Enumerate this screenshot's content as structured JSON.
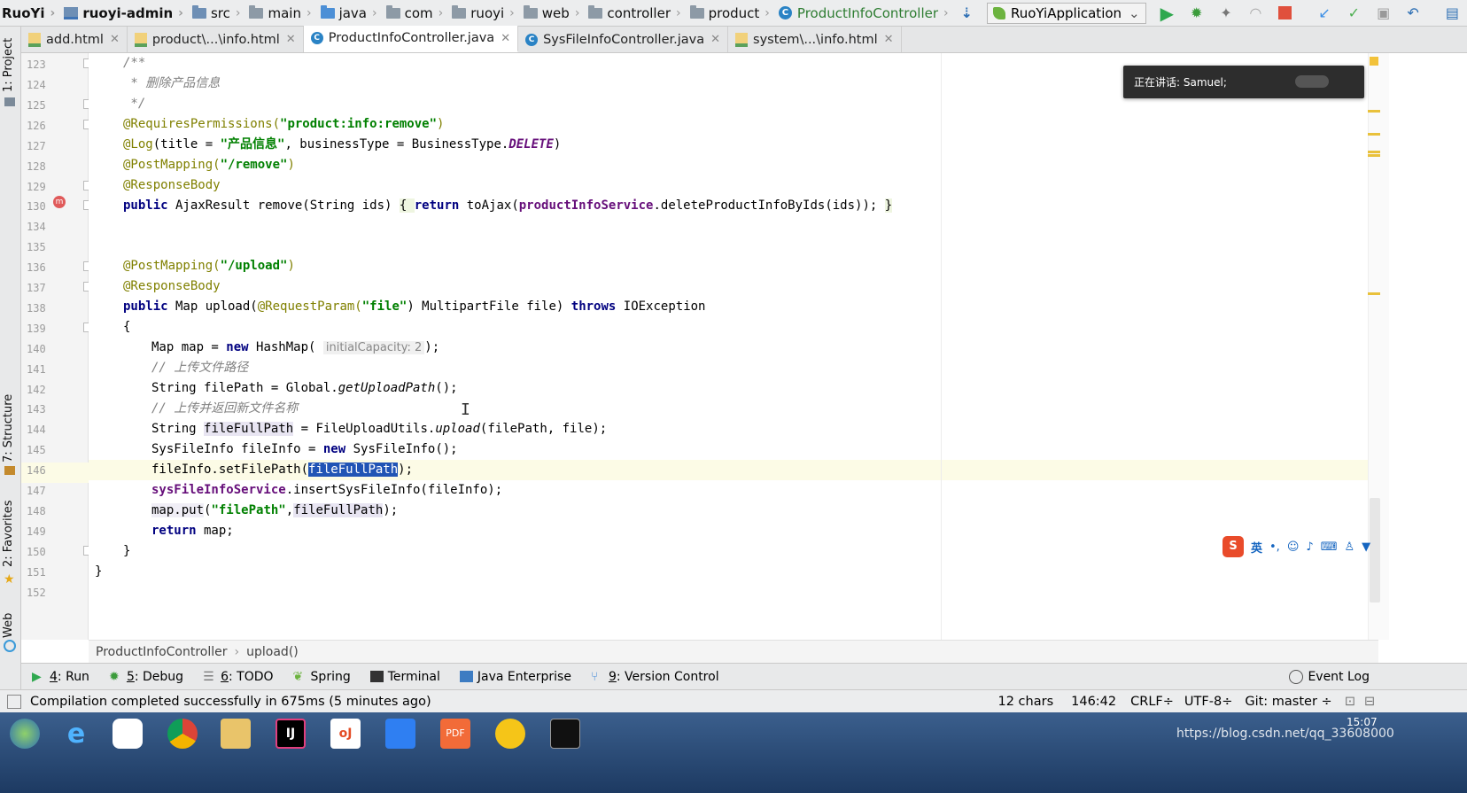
{
  "navbar": {
    "crumbs": [
      "RuoYi",
      "ruoyi-admin",
      "src",
      "main",
      "java",
      "com",
      "ruoyi",
      "web",
      "controller",
      "product",
      "ProductInfoController"
    ],
    "run_config": "RuoYiApplication"
  },
  "tabs": [
    "add.html",
    "product\\...\\info.html",
    "ProductInfoController.java",
    "SysFileInfoController.java",
    "system\\...\\info.html"
  ],
  "side": {
    "project": "1: Project",
    "structure": "7: Structure",
    "favorites": "2: Favorites",
    "web": "Web"
  },
  "popup": "正在讲话: Samuel;",
  "editor": {
    "line_numbers": [
      "123",
      "124",
      "125",
      "126",
      "127",
      "128",
      "129",
      "130",
      "134",
      "135",
      "136",
      "137",
      "138",
      "139",
      "140",
      "141",
      "142",
      "143",
      "144",
      "145",
      "146",
      "147",
      "148",
      "149",
      "150",
      "151",
      "152"
    ],
    "code": {
      "l123": "/**",
      "l124": " * 删除产品信息",
      "l125": " */",
      "l126a": "@RequiresPermissions(",
      "l126b": "\"product:info:remove\"",
      "l126c": ")",
      "l127a": "@Log",
      "l127b": "(title = ",
      "l127c": "\"产品信息\"",
      "l127d": ", businessType = BusinessType.",
      "l127e": "DELETE",
      "l127f": ")",
      "l128a": "@PostMapping(",
      "l128b": "\"/remove\"",
      "l128c": ")",
      "l129": "@ResponseBody",
      "l130a": "public",
      "l130b": " AjaxResult remove(String ids) ",
      "l130c": "{ ",
      "l130d": "return",
      "l130e": " toAjax(",
      "l130f": "productInfoService",
      "l130g": ".deleteProductInfoByIds(ids)); ",
      "l130h": "}",
      "l136a": "@PostMapping(",
      "l136b": "\"/upload\"",
      "l136c": ")",
      "l137": "@ResponseBody",
      "l138a": "public",
      "l138b": " Map upload(",
      "l138c": "@RequestParam(",
      "l138d": "\"file\"",
      "l138e": ") MultipartFile file) ",
      "l138f": "throws",
      "l138g": " IOException",
      "l139": "{",
      "l140a": "Map map = ",
      "l140b": "new",
      "l140c": " HashMap(",
      "l140d": "initialCapacity: 2",
      "l140e": ");",
      "l141": "// 上传文件路径",
      "l142a": "String filePath = Global.",
      "l142b": "getUploadPath",
      "l142c": "();",
      "l143": "// 上传并返回新文件名称",
      "l144a": "String ",
      "l144b": "fileFullPath",
      "l144c": " = FileUploadUtils.",
      "l144d": "upload",
      "l144e": "(filePath, file);",
      "l145a": "SysFileInfo fileInfo = ",
      "l145b": "new",
      "l145c": " SysFileInfo();",
      "l146a": "fileInfo.setFilePath(",
      "l146b": "fileFullPath",
      "l146c": ");",
      "l147a": "sysFileInfoService",
      "l147b": ".insertSysFileInfo(fileInfo);",
      "l148a": "map.put",
      "l148b": "(",
      "l148c": "\"filePath\"",
      "l148d": ",",
      "l148e": "fileFullPath",
      "l148f": ");",
      "l149a": "return",
      "l149b": " map;",
      "l150": "}",
      "l151": "}"
    }
  },
  "breadcrumb": {
    "cls": "ProductInfoController",
    "method": "upload()"
  },
  "tool_windows": [
    {
      "key": "4",
      "label": ": Run"
    },
    {
      "key": "5",
      "label": ": Debug"
    },
    {
      "key": "6",
      "label": ": TODO"
    },
    {
      "key": "",
      "label": "Spring"
    },
    {
      "key": "",
      "label": "Terminal"
    },
    {
      "key": "",
      "label": "Java Enterprise"
    },
    {
      "key": "9",
      "label": ": Version Control"
    }
  ],
  "event_log": "Event Log",
  "status": {
    "message": "Compilation completed successfully in 675ms (5 minutes ago)",
    "chars": "12 chars",
    "position": "146:42",
    "line_sep": "CRLF÷",
    "encoding": "UTF-8÷",
    "git": "Git: master ÷"
  },
  "ime": "英",
  "taskbar": {
    "time": "15:07",
    "watermark": "https://blog.csdn.net/qq_33608000"
  },
  "colors": {
    "keyword": "#000080",
    "string": "#008000",
    "annotation": "#808000",
    "field": "#660e7a",
    "selection": "#2154b5"
  }
}
